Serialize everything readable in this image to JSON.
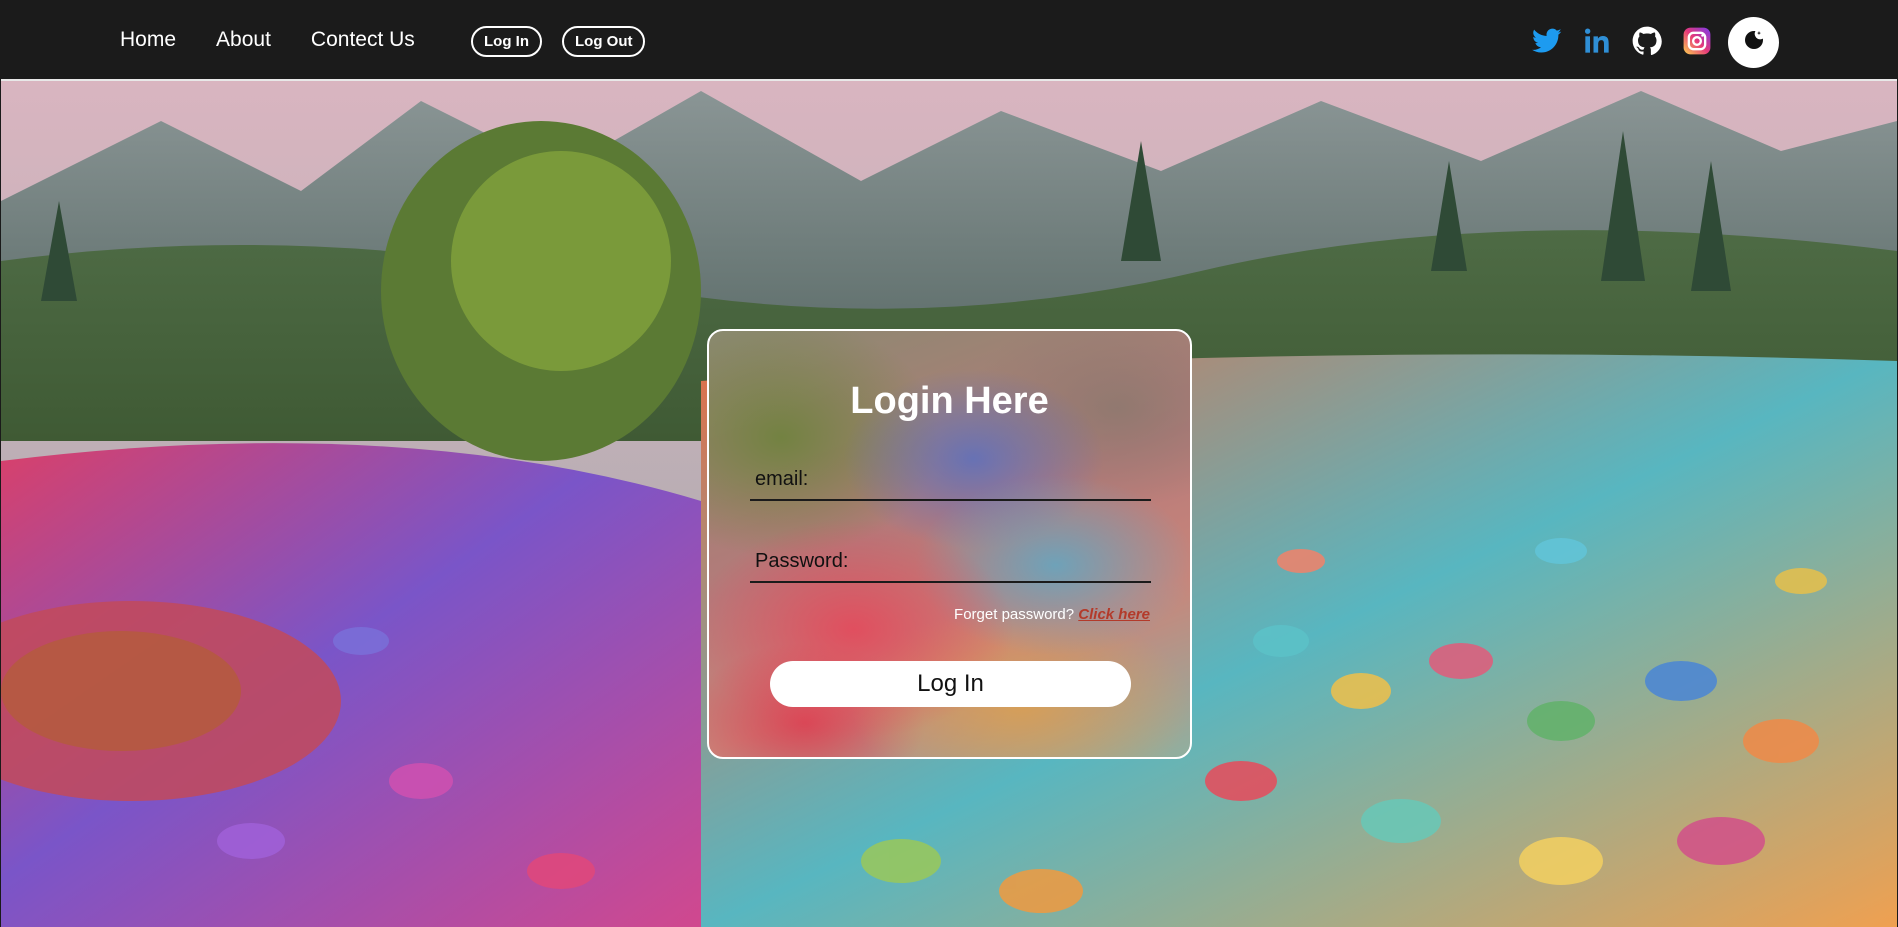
{
  "nav": {
    "links": [
      "Home",
      "About",
      "Contect Us"
    ],
    "login_button": "Log In",
    "logout_button": "Log Out"
  },
  "social": {
    "icons": [
      "twitter-icon",
      "linkedin-icon",
      "github-icon",
      "instagram-icon"
    ],
    "theme_toggle_icon": "moon-icon"
  },
  "colors": {
    "navbar": "#1b1b1b",
    "twitter": "#1d9bf0",
    "linkedin": "#2f8fd6",
    "instagram_gradient": [
      "#fdd34f",
      "#e5397a",
      "#7c3aed"
    ],
    "link_accent": "#b33a2a"
  },
  "login": {
    "title": "Login Here",
    "email_label": "email:",
    "password_label": "Password:",
    "forget_text": "Forget password?",
    "forget_link": "Click here",
    "submit_label": "Log In"
  }
}
